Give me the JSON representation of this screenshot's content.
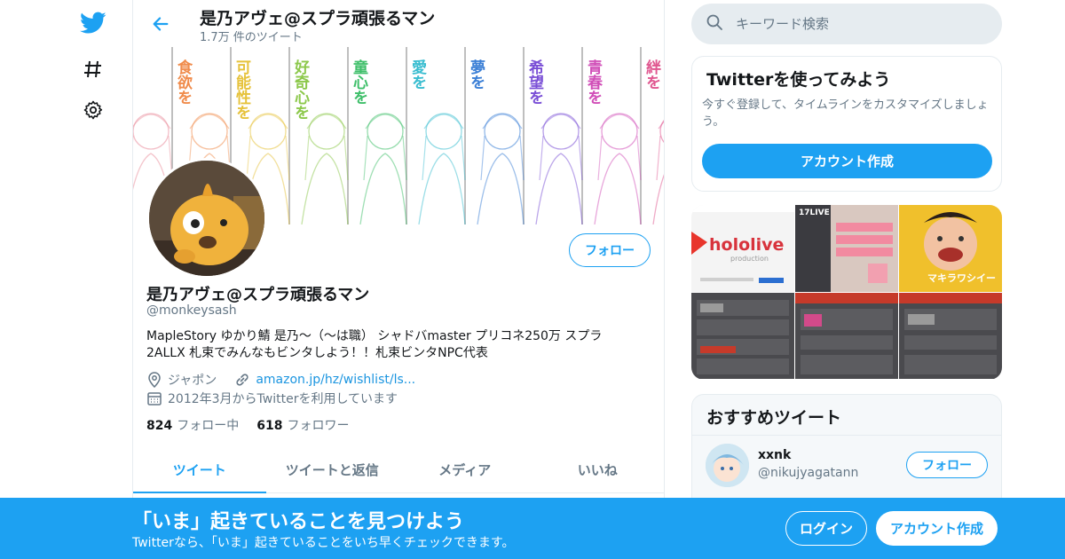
{
  "colors": {
    "accent": "#1da1f2",
    "secondary_text": "#657786",
    "border": "#e6ecf0"
  },
  "nav": {
    "icons": [
      "twitter-logo-icon",
      "hashtag-icon",
      "gear-icon"
    ]
  },
  "header": {
    "title": "是乃アヴェ@スプラ頑張るマン",
    "tweet_count": "1.7万 件のツイート"
  },
  "banner": {
    "labels": [
      "食欲を",
      "可能性を",
      "好奇心を",
      "童心を",
      "愛を",
      "夢を",
      "希望を",
      "青春を",
      "絆を"
    ],
    "label_colors": [
      "#e98b9a",
      "#f08c4c",
      "#e6c23b",
      "#8cc84b",
      "#3fbf6a",
      "#39bdd0",
      "#3b7fd6",
      "#7a4fd6",
      "#d14fb8",
      "#e05790"
    ]
  },
  "profile": {
    "follow_label": "フォロー",
    "name": "是乃アヴェ@スプラ頑張るマン",
    "handle": "@monkeysash",
    "bio": "MapleStory ゆかり鯖 是乃～（～は職） シャドバmaster プリコネ250万 スプラ2ALLX 札束でみんなもビンタしよう！！札束ビンタNPC代表",
    "location": "ジャポン",
    "url": "amazon.jp/hz/wishlist/ls...",
    "joined": "2012年3月からTwitterを利用しています",
    "following_count": "824",
    "following_label": "フォロー中",
    "followers_count": "618",
    "followers_label": "フォロワー"
  },
  "tabs": [
    "ツイート",
    "ツイートと返信",
    "メディア",
    "いいね"
  ],
  "search": {
    "placeholder": "キーワード検索"
  },
  "signup_card": {
    "title": "Twitterを使ってみよう",
    "desc": "今すぐ登録して、タイムラインをカスタマイズしましょう。",
    "button": "アカウント作成"
  },
  "media": {
    "thumb1_text": "hololive",
    "thumb1_sub": "production",
    "thumb2_tag": "17LIVE",
    "thumb3_text": "マキラワシイー"
  },
  "recommended": {
    "title": "おすすめツイート",
    "user_name": "xxnk",
    "user_handle": "@nikujyagatann",
    "follow_label": "フォロー"
  },
  "bottom_bar": {
    "title": "「いま」起きていることを見つけよう",
    "subtitle": "Twitterなら、「いま」起きていることをいち早くチェックできます。",
    "login": "ログイン",
    "signup": "アカウント作成"
  }
}
